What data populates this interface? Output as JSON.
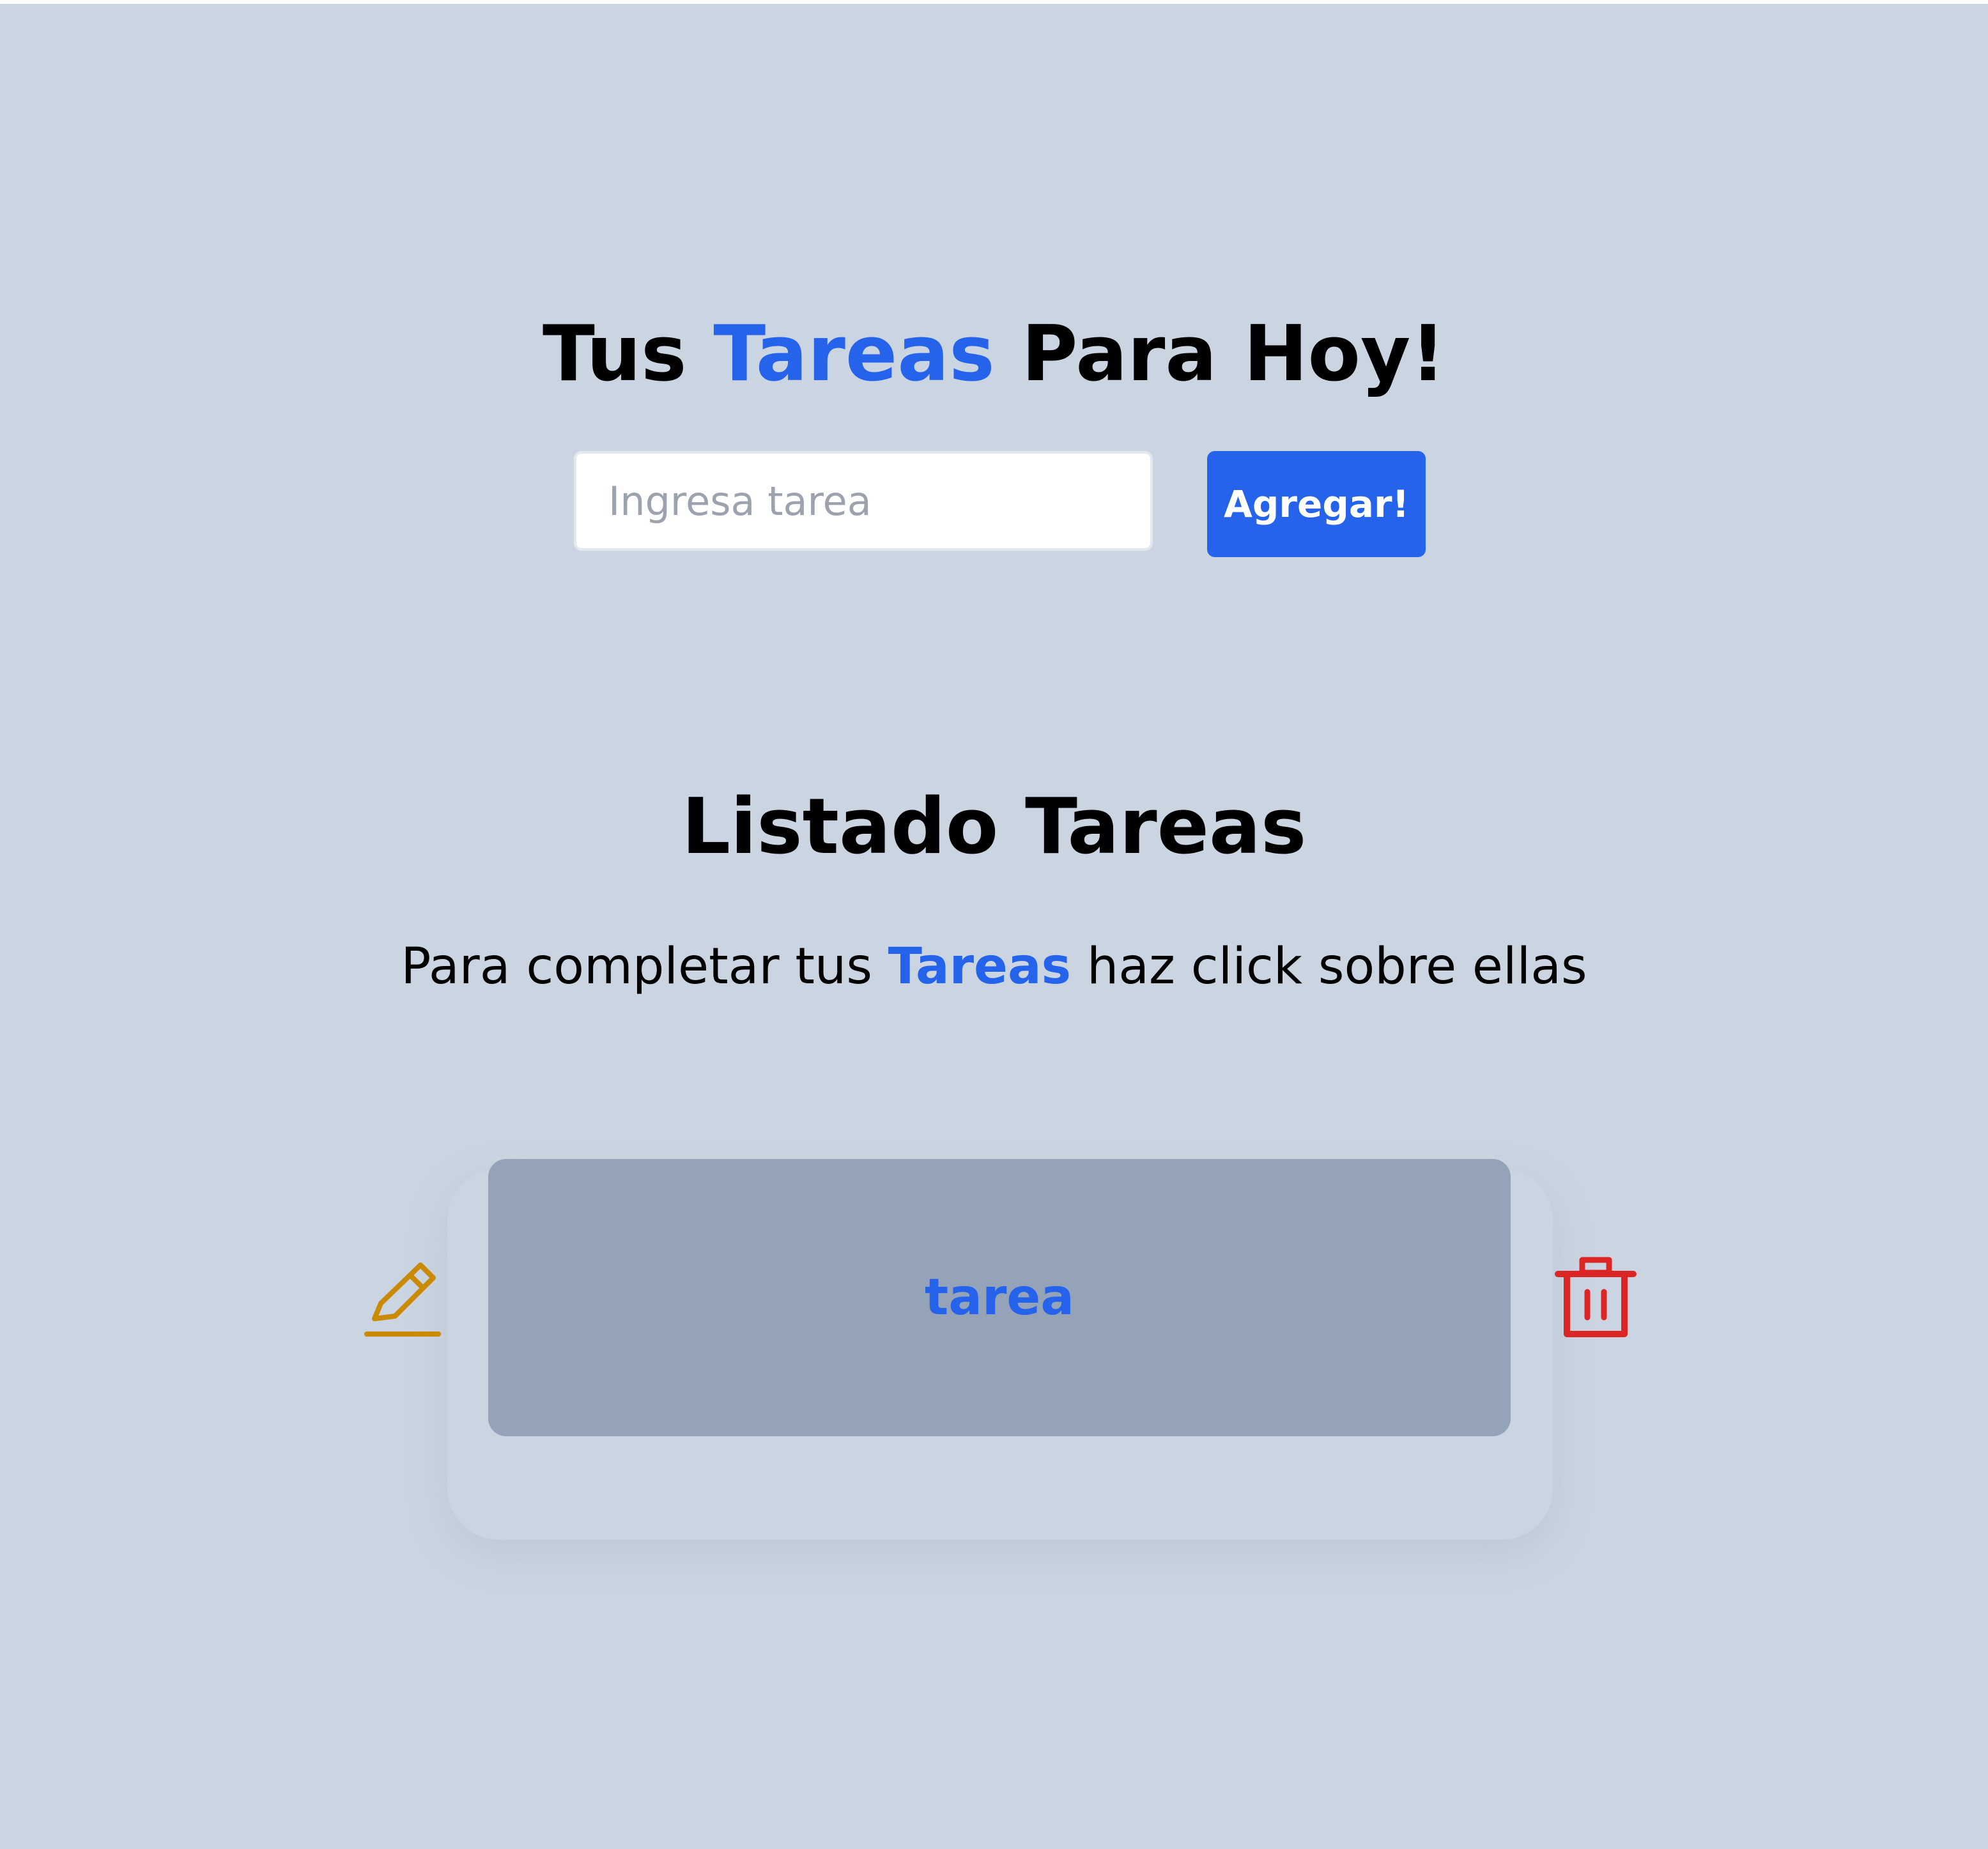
{
  "header": {
    "title_prefix": "Tus",
    "title_accent": "Tareas",
    "title_suffix": "Para Hoy!"
  },
  "form": {
    "input_value": "",
    "input_placeholder": "Ingresa tarea",
    "add_label": "Agregar!"
  },
  "list": {
    "title": "Listado Tareas",
    "hint_prefix": "Para completar tus",
    "hint_accent": "Tareas",
    "hint_suffix": "haz click sobre ellas",
    "items": [
      {
        "label": "tarea",
        "edit_icon": "pencil-icon",
        "delete_icon": "trash-icon"
      }
    ]
  },
  "colors": {
    "background": "#cbd5e1",
    "accent": "#2563eb",
    "card": "#94a3b8",
    "edit": "#ca8a04",
    "delete": "#dc2626"
  }
}
